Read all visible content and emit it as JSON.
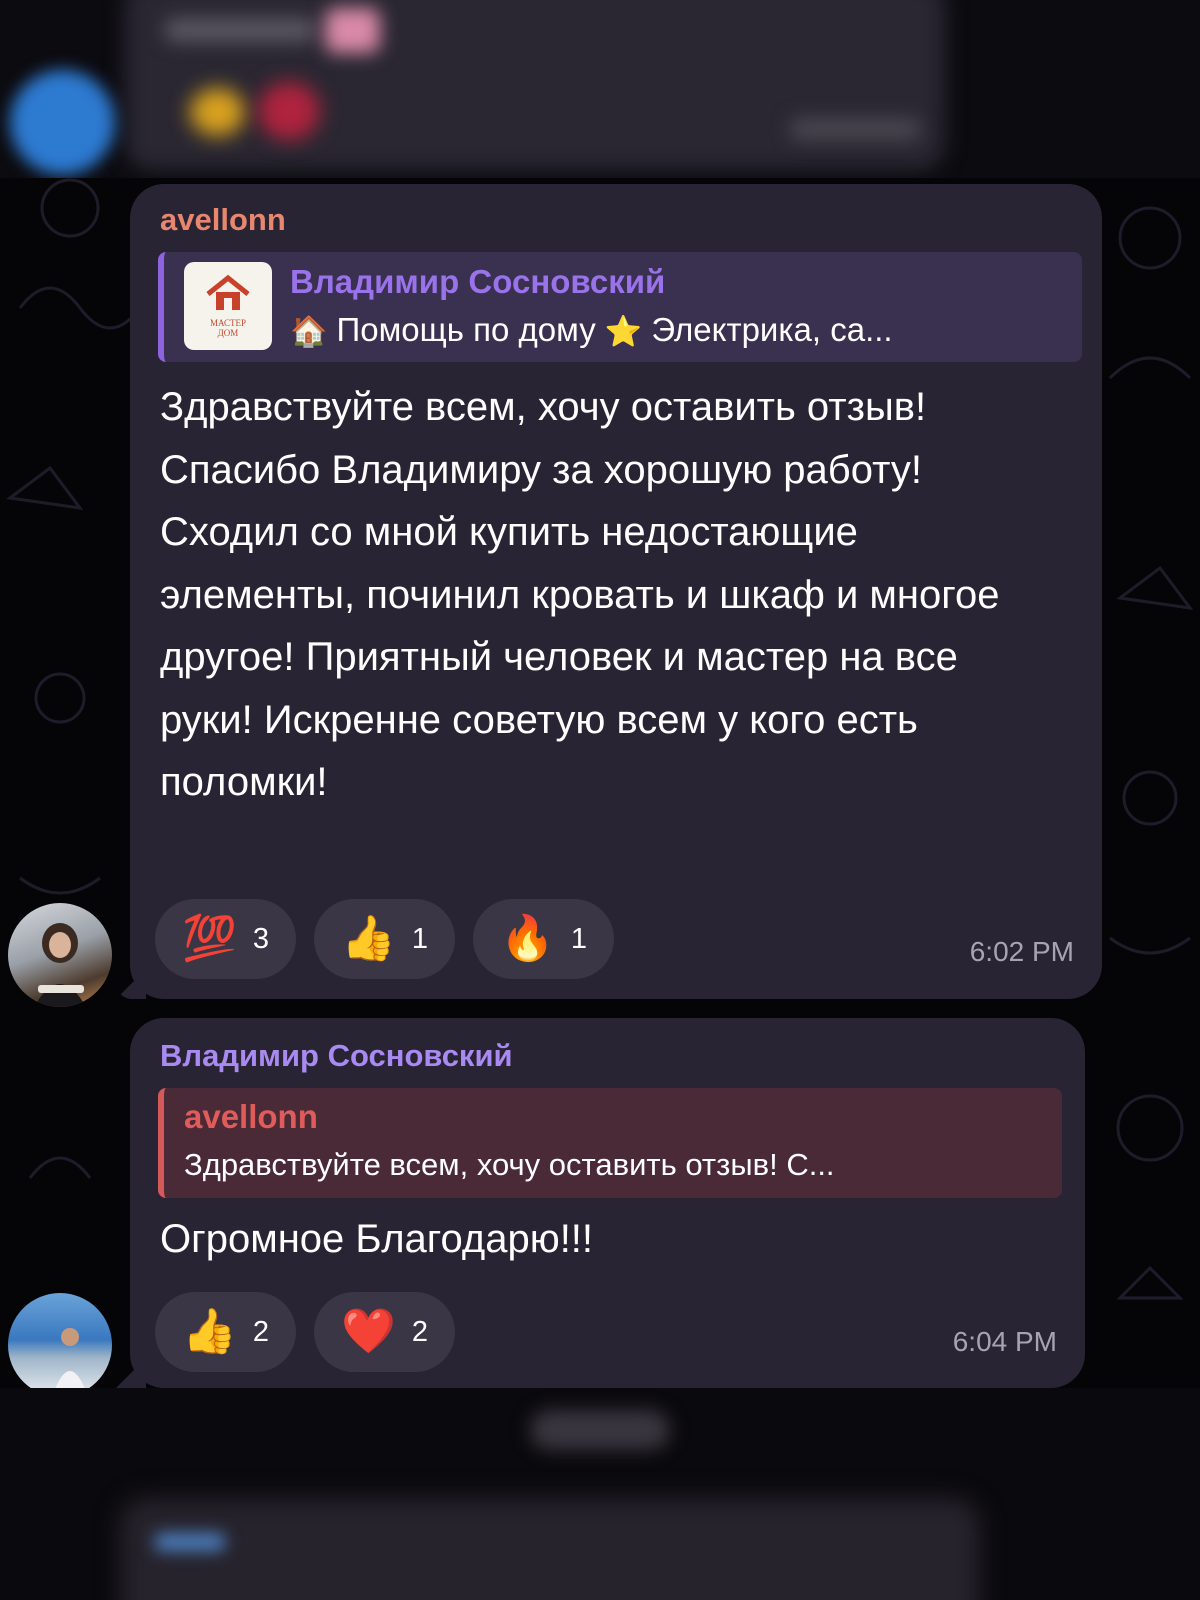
{
  "messages": [
    {
      "sender": "avellonn",
      "reply": {
        "name": "Владимир Сосновский",
        "text_prefix_emoji": "🏠",
        "text_part1": "Помощь по дому",
        "text_mid_emoji": "⭐",
        "text_part2": "Электрика, са...",
        "thumb_text_line1": "МАСТЕР",
        "thumb_text_line2": "ДОМ"
      },
      "text": "Здравствуйте всем, хочу оставить отзыв! Спасибо Владимиру за хорошую работу! Сходил со мной купить недостающие элементы, починил кровать и шкаф и многое другое! Приятный человек и мастер на все руки! Искренне советую всем у кого есть поломки!",
      "reactions": [
        {
          "emoji": "💯",
          "count": "3"
        },
        {
          "emoji": "👍",
          "count": "1"
        },
        {
          "emoji": "🔥",
          "count": "1"
        }
      ],
      "time": "6:02 PM"
    },
    {
      "sender": "Владимир Сосновский",
      "reply": {
        "name": "avellonn",
        "text": "Здравствуйте всем, хочу оставить отзыв! С..."
      },
      "text": "Огромное Благодарю!!!",
      "reactions": [
        {
          "emoji": "👍",
          "count": "2"
        },
        {
          "emoji": "❤️",
          "count": "2"
        }
      ],
      "time": "6:04 PM"
    }
  ],
  "colors": {
    "background": "#050407",
    "bubble": "#282434",
    "sender1": "#e8876f",
    "sender2": "#a98af0",
    "reply_accent1": "#8e63df",
    "reply_accent2": "#d35a58"
  }
}
